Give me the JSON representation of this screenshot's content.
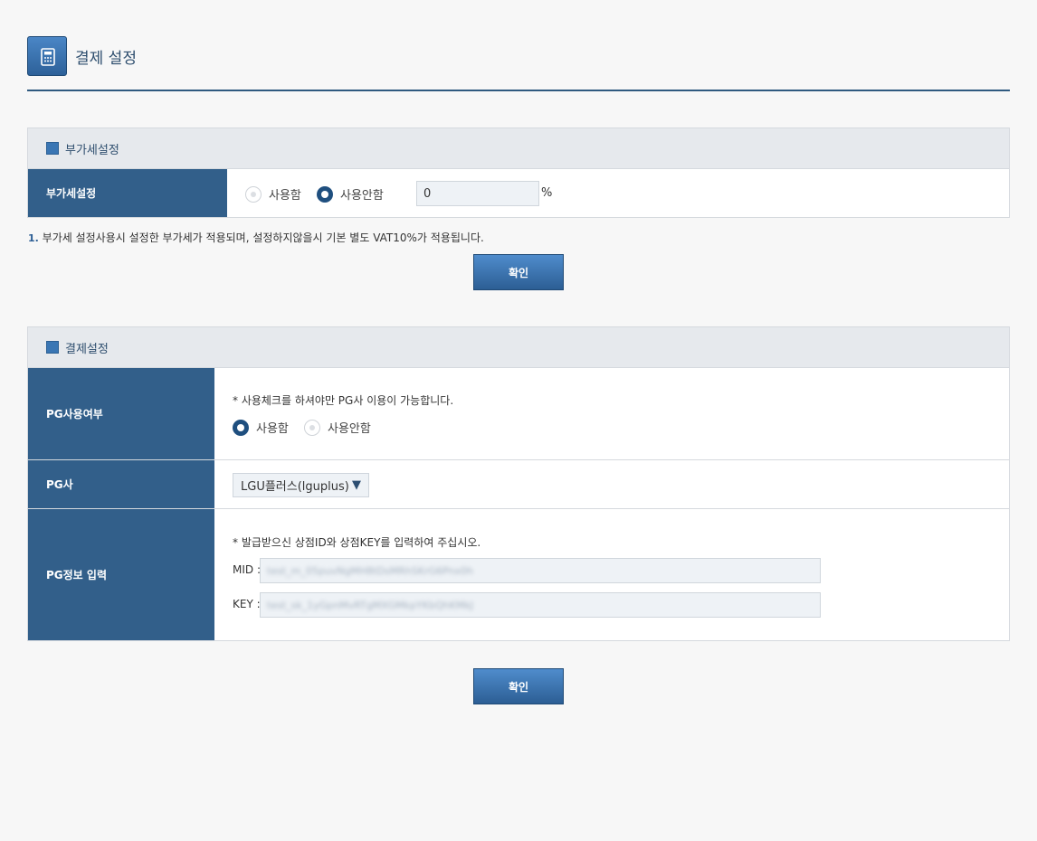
{
  "header": {
    "title": "결제 설정",
    "icon": "calculator-icon"
  },
  "vat_section": {
    "title": "부가세설정",
    "row_label": "부가세설정",
    "options": [
      "사용함",
      "사용안함"
    ],
    "selected": "사용안함",
    "rate_value": "0",
    "unit": "%",
    "note_index": "1.",
    "note": "부가세 설정사용시 설정한 부가세가 적용되며, 설정하지않을시 기본 별도 VAT10%가 적용됩니다.",
    "confirm_label": "확인"
  },
  "payment_section": {
    "title": "결제설정",
    "pg_use": {
      "label": "PG사용여부",
      "hint": "* 사용체크를 하셔야만 PG사 이용이 가능합니다.",
      "options": [
        "사용함",
        "사용안함"
      ],
      "selected": "사용함"
    },
    "pg_company": {
      "label": "PG사",
      "selected": "LGU플러스(lguplus)",
      "caret": "▼"
    },
    "pg_info": {
      "label": "PG정보 입력",
      "hint": "* 발급받으신 상점ID와 상점KEY를 입력하여 주십시오.",
      "mid_label": "MID :",
      "mid_value": "test_m_05puvNgMH8tDsMRhSKrG6Pnx0h",
      "key_label": "KEY :",
      "key_value": "test_sk_1yGpnMvRTgMXGMkpYKbQhKMkJ"
    },
    "confirm_label": "확인"
  },
  "colors": {
    "accent": "#325f8a",
    "section_bg": "#e6e9ed",
    "button": "#3a73b0"
  }
}
